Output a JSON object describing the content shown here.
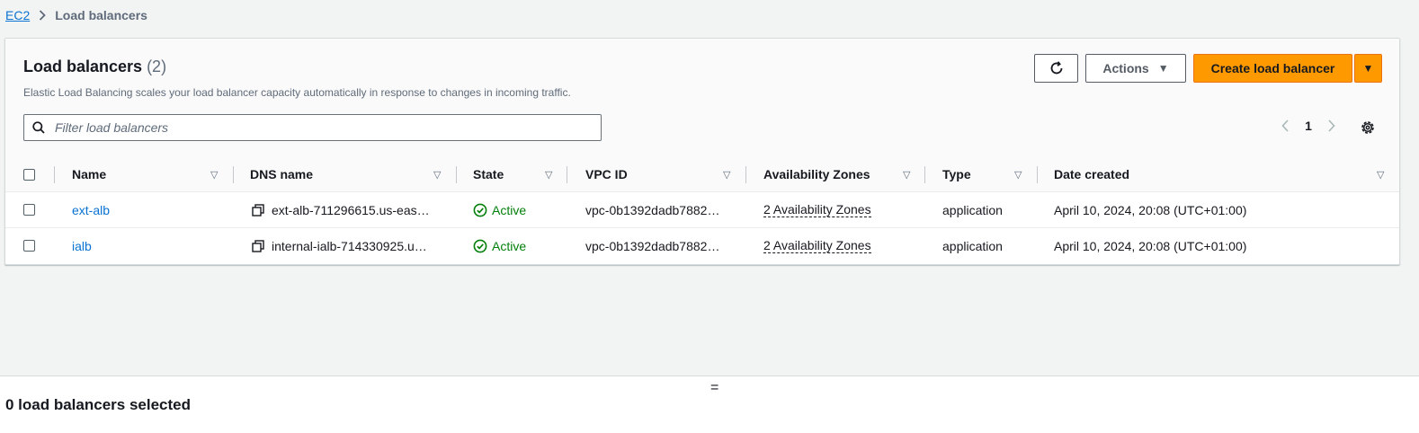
{
  "breadcrumb": {
    "root": "EC2",
    "current": "Load balancers"
  },
  "header": {
    "title": "Load balancers",
    "count": "(2)",
    "description": "Elastic Load Balancing scales your load balancer capacity automatically in response to changes in incoming traffic.",
    "actions_label": "Actions",
    "create_label": "Create load balancer"
  },
  "filter": {
    "placeholder": "Filter load balancers"
  },
  "pagination": {
    "current_page": "1"
  },
  "table": {
    "columns": [
      "Name",
      "DNS name",
      "State",
      "VPC ID",
      "Availability Zones",
      "Type",
      "Date created"
    ],
    "rows": [
      {
        "name": "ext-alb",
        "dns": "ext-alb-711296615.us-eas…",
        "state": "Active",
        "vpc": "vpc-0b1392dadb7882…",
        "az": "2 Availability Zones",
        "type": "application",
        "date": "April 10, 2024, 20:08 (UTC+01:00)"
      },
      {
        "name": "ialb",
        "dns": "internal-ialb-714330925.u…",
        "state": "Active",
        "vpc": "vpc-0b1392dadb7882…",
        "az": "2 Availability Zones",
        "type": "application",
        "date": "April 10, 2024, 20:08 (UTC+01:00)"
      }
    ]
  },
  "split_panel": {
    "handle": "=",
    "selected_text": "0 load balancers selected"
  },
  "colors": {
    "accent": "#ff9900",
    "link": "#0972d3",
    "success": "#037f0c"
  }
}
